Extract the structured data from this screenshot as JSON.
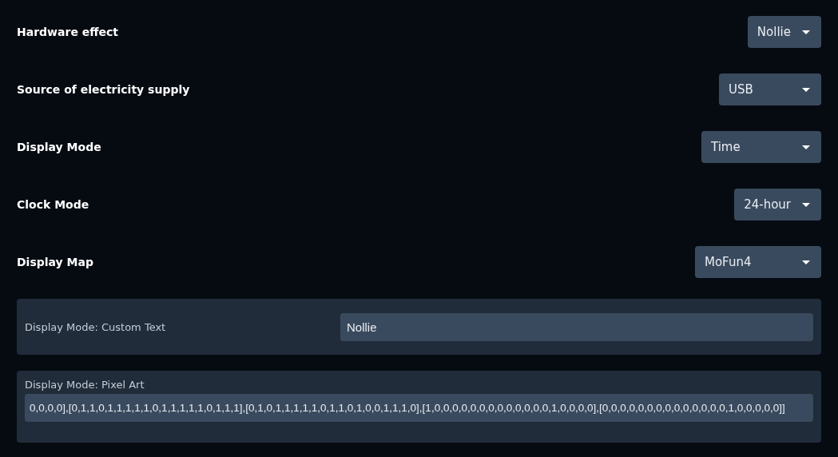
{
  "settings": [
    {
      "label": "Hardware effect",
      "value": "Nollie"
    },
    {
      "label": "Source of electricity supply",
      "value": "USB"
    },
    {
      "label": "Display Mode",
      "value": "Time"
    },
    {
      "label": "Clock Mode",
      "value": "24-hour"
    },
    {
      "label": "Display Map",
      "value": "MoFun4"
    }
  ],
  "custom_text": {
    "label": "Display Mode: Custom Text",
    "value": "Nollie"
  },
  "pixel_art": {
    "label": "Display Mode: Pixel Art",
    "value": "0,0,0,0],[0,1,1,0,1,1,1,1,1,0,1,1,1,1,1,0,1,1,1],[0,1,0,1,1,1,1,1,0,1,1,0,1,0,0,1,1,1,0],[1,0,0,0,0,0,0,0,0,0,0,0,0,0,1,0,0,0,0],[0,0,0,0,0,0,0,0,0,0,0,0,0,0,1,0,0,0,0,0]]"
  }
}
